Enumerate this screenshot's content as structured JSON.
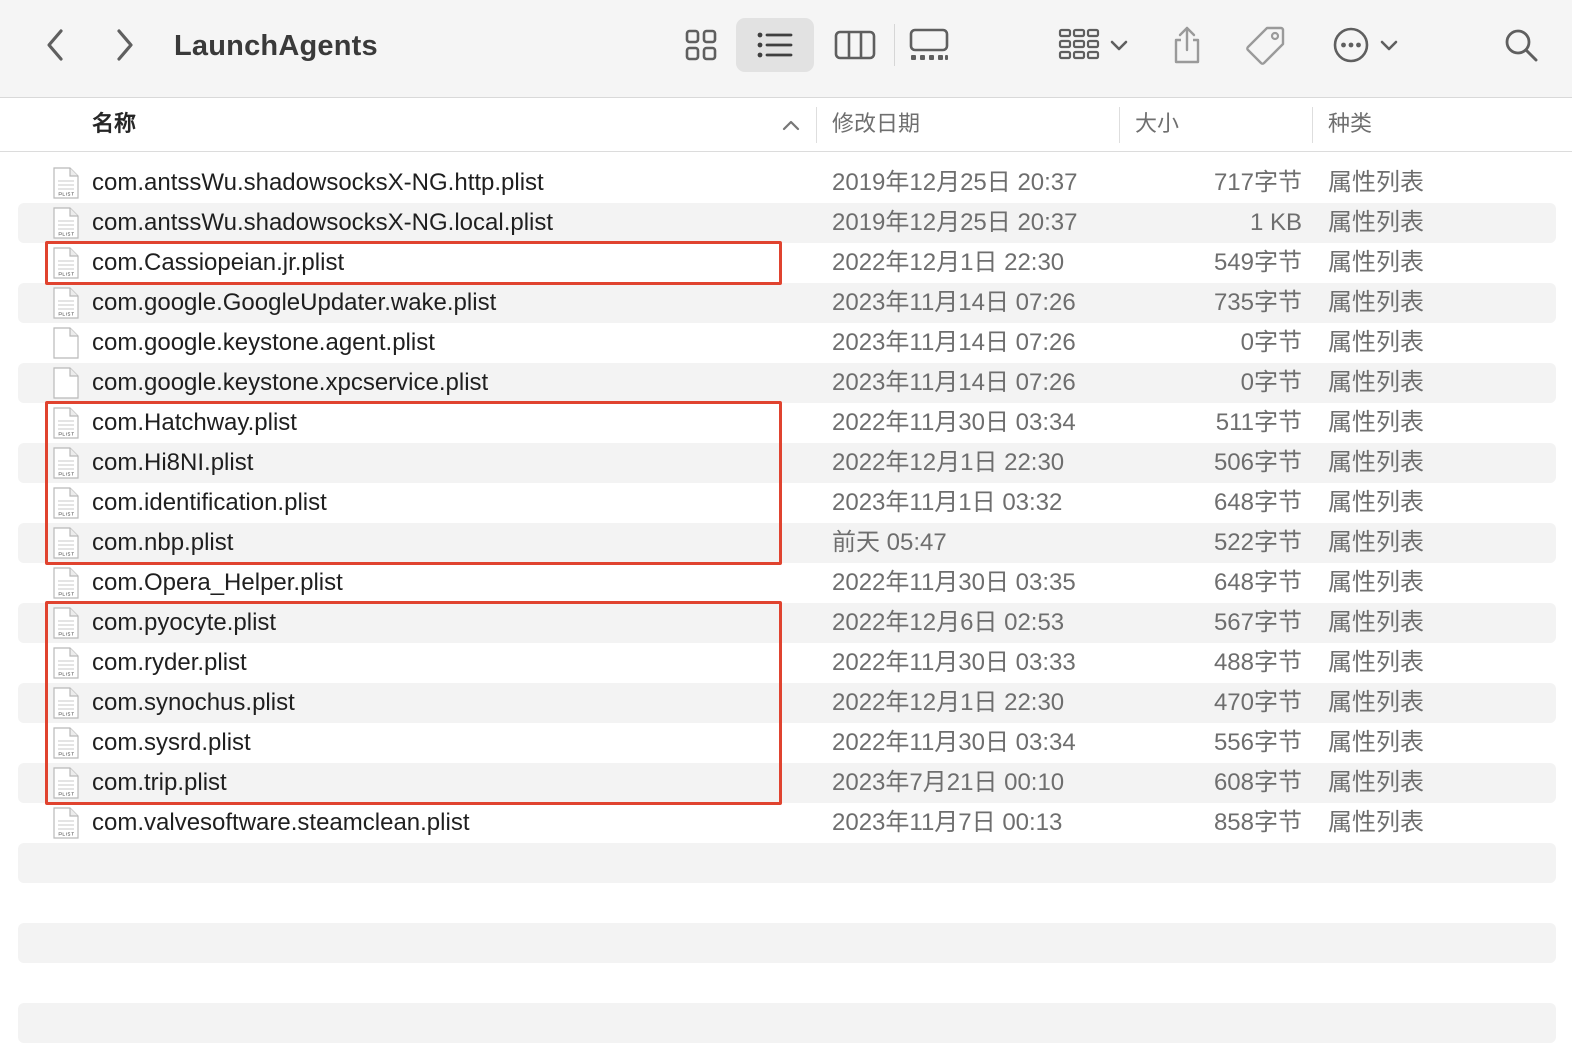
{
  "toolbar": {
    "back_icon": "chevron-left-icon",
    "forward_icon": "chevron-right-icon",
    "title": "LaunchAgents",
    "views": [
      "icon-grid-icon",
      "list-view-icon",
      "column-view-icon",
      "gallery-view-icon"
    ],
    "selected_view": "list",
    "group_icon": "group-icon",
    "share_icon": "share-icon",
    "tag_icon": "tag-icon",
    "action_icon": "ellipsis-circle-icon",
    "search_icon": "search-icon"
  },
  "columns": {
    "name": "名称",
    "date": "修改日期",
    "size": "大小",
    "kind": "种类",
    "sort": "name-ascending"
  },
  "files": [
    {
      "name": "com.antssWu.shadowsocksX-NG.http.plist",
      "date": "2019年12月25日 20:37",
      "size": "717字节",
      "kind": "属性列表",
      "icon": "plist-file-icon"
    },
    {
      "name": "com.antssWu.shadowsocksX-NG.local.plist",
      "date": "2019年12月25日 20:37",
      "size": "1 KB",
      "kind": "属性列表",
      "icon": "plist-file-icon"
    },
    {
      "name": "com.Cassiopeian.jr.plist",
      "date": "2022年12月1日 22:30",
      "size": "549字节",
      "kind": "属性列表",
      "icon": "plist-file-icon"
    },
    {
      "name": "com.google.GoogleUpdater.wake.plist",
      "date": "2023年11月14日 07:26",
      "size": "735字节",
      "kind": "属性列表",
      "icon": "plist-file-icon"
    },
    {
      "name": "com.google.keystone.agent.plist",
      "date": "2023年11月14日 07:26",
      "size": "0字节",
      "kind": "属性列表",
      "icon": "blank-file-icon"
    },
    {
      "name": "com.google.keystone.xpcservice.plist",
      "date": "2023年11月14日 07:26",
      "size": "0字节",
      "kind": "属性列表",
      "icon": "blank-file-icon"
    },
    {
      "name": "com.Hatchway.plist",
      "date": "2022年11月30日 03:34",
      "size": "511字节",
      "kind": "属性列表",
      "icon": "plist-file-icon"
    },
    {
      "name": "com.Hi8NI.plist",
      "date": "2022年12月1日 22:30",
      "size": "506字节",
      "kind": "属性列表",
      "icon": "plist-file-icon"
    },
    {
      "name": "com.identification.plist",
      "date": "2023年11月1日 03:32",
      "size": "648字节",
      "kind": "属性列表",
      "icon": "plist-file-icon"
    },
    {
      "name": "com.nbp.plist",
      "date": "前天 05:47",
      "size": "522字节",
      "kind": "属性列表",
      "icon": "plist-file-icon"
    },
    {
      "name": "com.Opera_Helper.plist",
      "date": "2022年11月30日 03:35",
      "size": "648字节",
      "kind": "属性列表",
      "icon": "plist-file-icon"
    },
    {
      "name": "com.pyocyte.plist",
      "date": "2022年12月6日 02:53",
      "size": "567字节",
      "kind": "属性列表",
      "icon": "plist-file-icon"
    },
    {
      "name": "com.ryder.plist",
      "date": "2022年11月30日 03:33",
      "size": "488字节",
      "kind": "属性列表",
      "icon": "plist-file-icon"
    },
    {
      "name": "com.synochus.plist",
      "date": "2022年12月1日 22:30",
      "size": "470字节",
      "kind": "属性列表",
      "icon": "plist-file-icon"
    },
    {
      "name": "com.sysrd.plist",
      "date": "2022年11月30日 03:34",
      "size": "556字节",
      "kind": "属性列表",
      "icon": "plist-file-icon"
    },
    {
      "name": "com.trip.plist",
      "date": "2023年7月21日 00:10",
      "size": "608字节",
      "kind": "属性列表",
      "icon": "plist-file-icon"
    },
    {
      "name": "com.valvesoftware.steamclean.plist",
      "date": "2023年11月7日 00:13",
      "size": "858字节",
      "kind": "属性列表",
      "icon": "plist-file-icon"
    }
  ],
  "highlight_groups": [
    {
      "from_row": 3,
      "to_row": 3
    },
    {
      "from_row": 7,
      "to_row": 10
    },
    {
      "from_row": 12,
      "to_row": 16
    }
  ],
  "colors": {
    "highlight_border": "#e0432f",
    "stripe": "#f3f3f3",
    "toolbar_bg": "#f5f5f5",
    "selected_view_bg": "#e2e2e2"
  }
}
